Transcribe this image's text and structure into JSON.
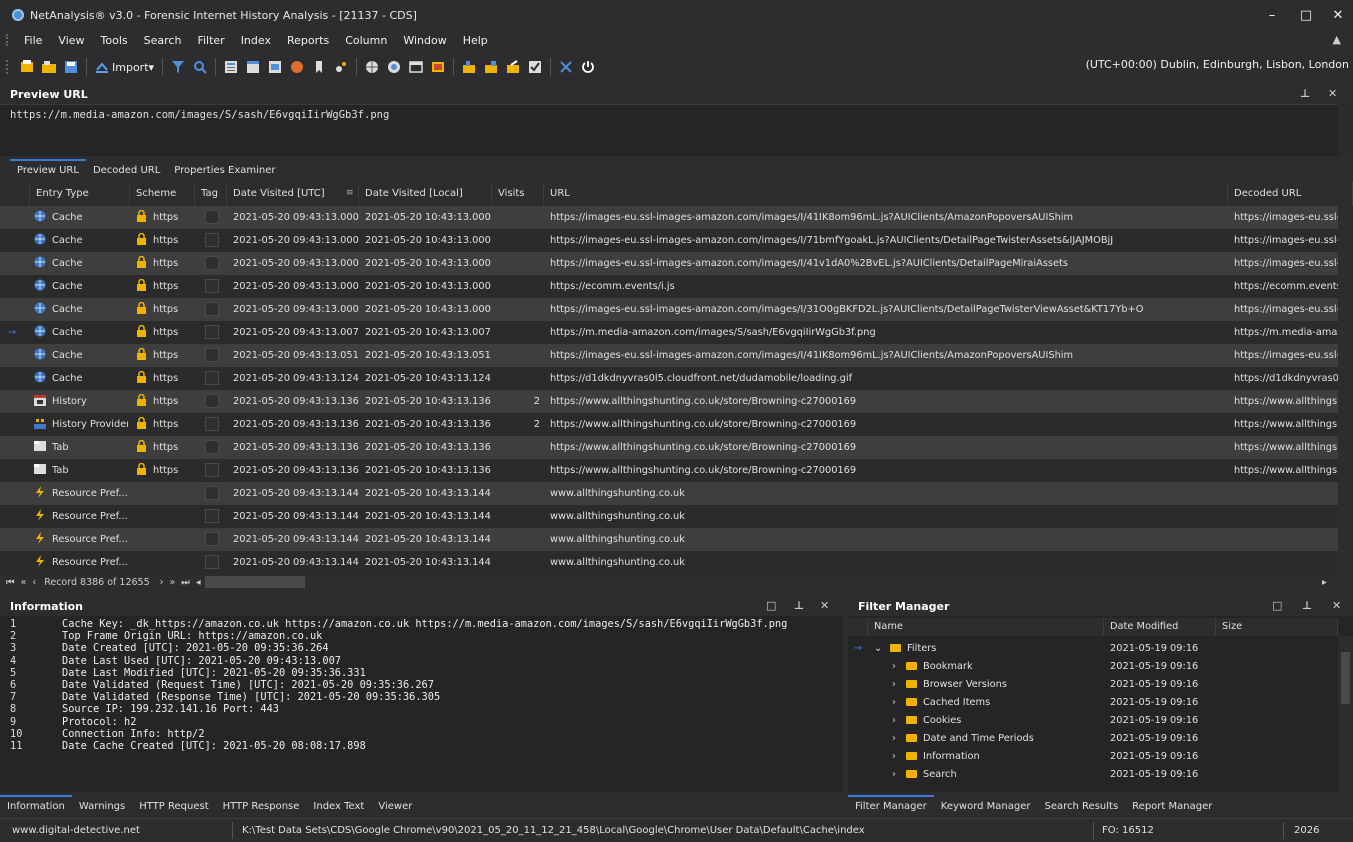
{
  "window": {
    "title": "NetAnalysis® v3.0 - Forensic Internet History Analysis - [21137 - CDS]",
    "minimize": "–",
    "maximize": "□",
    "close": "✕"
  },
  "menu": [
    "File",
    "View",
    "Tools",
    "Search",
    "Filter",
    "Index",
    "Reports",
    "Column",
    "Window",
    "Help"
  ],
  "toolbar": {
    "import_label": "Import",
    "timezone": "(UTC+00:00) Dublin, Edinburgh, Lisbon, London"
  },
  "preview": {
    "panel_title": "Preview URL",
    "url": "https://m.media-amazon.com/images/S/sash/E6vgqiIirWgGb3f.png",
    "tabs": [
      "Preview URL",
      "Decoded URL",
      "Properties Examiner"
    ]
  },
  "grid": {
    "columns": [
      "Entry Type",
      "Scheme",
      "Tag",
      "Date Visited [UTC]",
      "Date Visited [Local]",
      "Visits",
      "URL",
      "Decoded URL"
    ],
    "rows": [
      {
        "type": "Cache",
        "icon": "cache-icon",
        "scheme": "https",
        "utc": "2021-05-20 09:43:13.000",
        "local": "2021-05-20 10:43:13.000",
        "visits": "",
        "url": "https://images-eu.ssl-images-amazon.com/images/I/41IK8om96mL.js?AUIClients/AmazonPopoversAUIShim",
        "decoded": "https://images-eu.ssl-im"
      },
      {
        "type": "Cache",
        "icon": "cache-icon",
        "scheme": "https",
        "utc": "2021-05-20 09:43:13.000",
        "local": "2021-05-20 10:43:13.000",
        "visits": "",
        "url": "https://images-eu.ssl-images-amazon.com/images/I/71bmfYgoakL.js?AUIClients/DetailPageTwisterAssets&IJAJMOBjJ",
        "decoded": "https://images-eu.ssl-im"
      },
      {
        "type": "Cache",
        "icon": "cache-icon",
        "scheme": "https",
        "utc": "2021-05-20 09:43:13.000",
        "local": "2021-05-20 10:43:13.000",
        "visits": "",
        "url": "https://images-eu.ssl-images-amazon.com/images/I/41v1dA0%2BvEL.js?AUIClients/DetailPageMiraiAssets",
        "decoded": "https://images-eu.ssl-im"
      },
      {
        "type": "Cache",
        "icon": "cache-icon",
        "scheme": "https",
        "utc": "2021-05-20 09:43:13.000",
        "local": "2021-05-20 10:43:13.000",
        "visits": "",
        "url": "https://ecomm.events/i.js",
        "decoded": "https://ecomm.events/"
      },
      {
        "type": "Cache",
        "icon": "cache-icon",
        "scheme": "https",
        "utc": "2021-05-20 09:43:13.000",
        "local": "2021-05-20 10:43:13.000",
        "visits": "",
        "url": "https://images-eu.ssl-images-amazon.com/images/I/31O0gBKFD2L.js?AUIClients/DetailPageTwisterViewAsset&KT17Yb+O",
        "decoded": "https://images-eu.ssl-im"
      },
      {
        "type": "Cache",
        "icon": "cache-icon",
        "scheme": "https",
        "utc": "2021-05-20 09:43:13.007",
        "local": "2021-05-20 10:43:13.007",
        "visits": "",
        "url": "https://m.media-amazon.com/images/S/sash/E6vgqiIirWgGb3f.png",
        "decoded": "https://m.media-amazo",
        "current": true
      },
      {
        "type": "Cache",
        "icon": "cache-icon",
        "scheme": "https",
        "utc": "2021-05-20 09:43:13.051",
        "local": "2021-05-20 10:43:13.051",
        "visits": "",
        "url": "https://images-eu.ssl-images-amazon.com/images/I/41IK8om96mL.js?AUIClients/AmazonPopoversAUIShim",
        "decoded": "https://images-eu.ssl-im"
      },
      {
        "type": "Cache",
        "icon": "cache-icon",
        "scheme": "https",
        "utc": "2021-05-20 09:43:13.124",
        "local": "2021-05-20 10:43:13.124",
        "visits": "",
        "url": "https://d1dkdnyvras0l5.cloudfront.net/dudamobile/loading.gif",
        "decoded": "https://d1dkdnyvras0l5"
      },
      {
        "type": "History",
        "icon": "history-icon",
        "scheme": "https",
        "utc": "2021-05-20 09:43:13.136",
        "local": "2021-05-20 10:43:13.136",
        "visits": "2",
        "url": "https://www.allthingshunting.co.uk/store/Browning-c27000169",
        "decoded": "https://www.allthingsh"
      },
      {
        "type": "History Provider",
        "icon": "history-provider-icon",
        "scheme": "https",
        "utc": "2021-05-20 09:43:13.136",
        "local": "2021-05-20 10:43:13.136",
        "visits": "2",
        "url": "https://www.allthingshunting.co.uk/store/Browning-c27000169",
        "decoded": "https://www.allthingsh"
      },
      {
        "type": "Tab",
        "icon": "tab-icon",
        "scheme": "https",
        "utc": "2021-05-20 09:43:13.136",
        "local": "2021-05-20 10:43:13.136",
        "visits": "",
        "url": "https://www.allthingshunting.co.uk/store/Browning-c27000169",
        "decoded": "https://www.allthingsh"
      },
      {
        "type": "Tab",
        "icon": "tab-icon",
        "scheme": "https",
        "utc": "2021-05-20 09:43:13.136",
        "local": "2021-05-20 10:43:13.136",
        "visits": "",
        "url": "https://www.allthingshunting.co.uk/store/Browning-c27000169",
        "decoded": "https://www.allthingsh"
      },
      {
        "type": "Resource Pref...",
        "icon": "resource-prefetch-icon",
        "scheme": "",
        "utc": "2021-05-20 09:43:13.144",
        "local": "2021-05-20 10:43:13.144",
        "visits": "",
        "url": "www.allthingshunting.co.uk",
        "decoded": ""
      },
      {
        "type": "Resource Pref...",
        "icon": "resource-prefetch-icon",
        "scheme": "",
        "utc": "2021-05-20 09:43:13.144",
        "local": "2021-05-20 10:43:13.144",
        "visits": "",
        "url": "www.allthingshunting.co.uk",
        "decoded": ""
      },
      {
        "type": "Resource Pref...",
        "icon": "resource-prefetch-icon",
        "scheme": "",
        "utc": "2021-05-20 09:43:13.144",
        "local": "2021-05-20 10:43:13.144",
        "visits": "",
        "url": "www.allthingshunting.co.uk",
        "decoded": ""
      },
      {
        "type": "Resource Pref...",
        "icon": "resource-prefetch-icon",
        "scheme": "",
        "utc": "2021-05-20 09:43:13.144",
        "local": "2021-05-20 10:43:13.144",
        "visits": "",
        "url": "www.allthingshunting.co.uk",
        "decoded": ""
      }
    ],
    "record_text": "Record 8386 of 12655"
  },
  "information": {
    "title": "Information",
    "lines": [
      {
        "n": "1",
        "t": "Cache Key: _dk_https://amazon.co.uk https://amazon.co.uk https://m.media-amazon.com/images/S/sash/E6vgqiIirWgGb3f.png"
      },
      {
        "n": "2",
        "t": "Top Frame Origin URL: https://amazon.co.uk"
      },
      {
        "n": "3",
        "t": "Date Created [UTC]: 2021-05-20 09:35:36.264"
      },
      {
        "n": "4",
        "t": "Date Last Used [UTC]: 2021-05-20 09:43:13.007"
      },
      {
        "n": "5",
        "t": "Date Last Modified [UTC]: 2021-05-20 09:35:36.331"
      },
      {
        "n": "6",
        "t": "Date Validated (Request Time) [UTC]: 2021-05-20 09:35:36.267"
      },
      {
        "n": "7",
        "t": "Date Validated (Response Time) [UTC]: 2021-05-20 09:35:36.305"
      },
      {
        "n": "8",
        "t": "Source IP: 199.232.141.16 Port: 443"
      },
      {
        "n": "9",
        "t": "Protocol: h2"
      },
      {
        "n": "10",
        "t": "Connection Info: http/2"
      },
      {
        "n": "11",
        "t": "Date Cache Created [UTC]: 2021-05-20 08:08:17.898"
      }
    ],
    "tabs": [
      "Information",
      "Warnings",
      "HTTP Request",
      "HTTP Response",
      "Index Text",
      "Viewer"
    ]
  },
  "filter_manager": {
    "title": "Filter Manager",
    "columns": [
      "Name",
      "Date Modified",
      "Size"
    ],
    "root": {
      "name": "Filters",
      "date": "2021-05-19 09:16"
    },
    "items": [
      {
        "name": "Bookmark",
        "date": "2021-05-19 09:16"
      },
      {
        "name": "Browser Versions",
        "date": "2021-05-19 09:16"
      },
      {
        "name": "Cached Items",
        "date": "2021-05-19 09:16"
      },
      {
        "name": "Cookies",
        "date": "2021-05-19 09:16"
      },
      {
        "name": "Date and Time Periods",
        "date": "2021-05-19 09:16"
      },
      {
        "name": "Information",
        "date": "2021-05-19 09:16"
      },
      {
        "name": "Search",
        "date": "2021-05-19 09:16"
      }
    ],
    "tabs": [
      "Filter Manager",
      "Keyword Manager",
      "Search Results",
      "Report Manager"
    ]
  },
  "status": {
    "website": "www.digital-detective.net",
    "path": "K:\\Test Data Sets\\CDS\\Google Chrome\\v90\\2021_05_20_11_12_21_458\\Local\\Google\\Chrome\\User Data\\Default\\Cache\\index",
    "fo": "FO: 16512",
    "year": "2026"
  },
  "colors": {
    "accent": "#3c7bd3",
    "folder": "#f0b400",
    "lock": "#f0b400"
  }
}
